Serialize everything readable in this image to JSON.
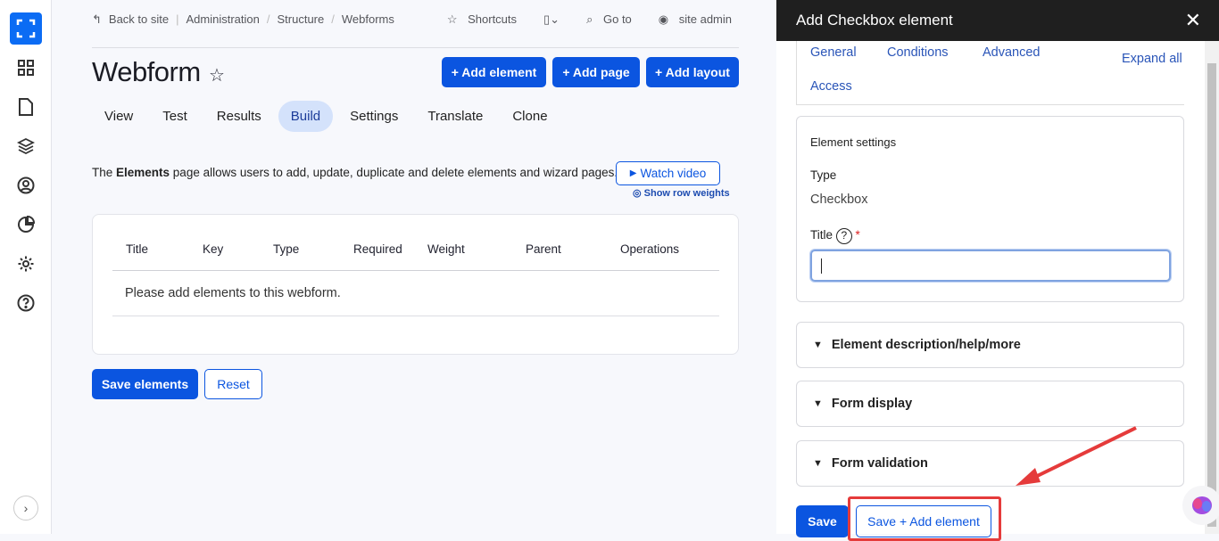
{
  "sidebar": {
    "items": [
      "dashboard",
      "content",
      "structure",
      "people",
      "reports",
      "configuration",
      "help"
    ],
    "expand_label": "›"
  },
  "topbar": {
    "back": "Back to site",
    "breadcrumb": [
      "Administration",
      "Structure",
      "Webforms"
    ],
    "shortcuts": "Shortcuts",
    "goto": "Go to",
    "user": "site admin"
  },
  "page": {
    "title": "Webform",
    "buttons": [
      "+ Add element",
      "+ Add page",
      "+ Add layout"
    ],
    "tabs": [
      "View",
      "Test",
      "Results",
      "Build",
      "Settings",
      "Translate",
      "Clone"
    ],
    "active_tab": "Build",
    "desc_pre": "The ",
    "desc_bold": "Elements",
    "desc_post": " page allows users to add, update, duplicate and delete elements and wizard pages.",
    "watch_video": "Watch video",
    "show_row_weights": "Show row weights",
    "table": {
      "headers": [
        "Title",
        "Key",
        "Type",
        "Required",
        "Weight",
        "Parent",
        "Operations"
      ],
      "empty": "Please add elements to this webform."
    },
    "save_elements": "Save elements",
    "reset": "Reset"
  },
  "panel": {
    "title": "Add Checkbox element",
    "tabs": [
      "General",
      "Conditions",
      "Advanced",
      "Access"
    ],
    "expand_all": "Expand all",
    "settings_title": "Element settings",
    "type_label": "Type",
    "type_value": "Checkbox",
    "title_label": "Title",
    "required_mark": "*",
    "title_value": "",
    "sections": [
      "Element description/help/more",
      "Form display",
      "Form validation"
    ],
    "save": "Save",
    "save_add": "Save + Add element"
  },
  "colors": {
    "primary": "#0b55e0",
    "annotation": "#e53b3b"
  }
}
